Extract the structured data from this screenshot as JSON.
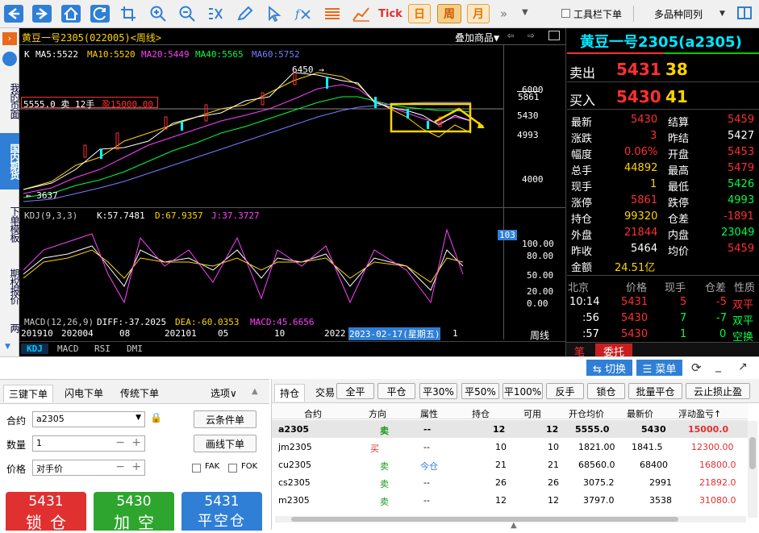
{
  "toolbar": {
    "back": "back-icon",
    "forward": "forward-icon",
    "home": "home-icon",
    "refresh": "refresh-icon",
    "crop": "crop-icon",
    "zoom_in": "zoom-in-icon",
    "zoom_out": "zoom-out-icon",
    "formula": "formula-icon",
    "draw": "pen-icon",
    "cursor": "cursor-icon",
    "fx": "fx-icon",
    "list": "list-icon",
    "kline": "kline-icon",
    "tick_label": "Tick",
    "day_label": "日",
    "week_label": "周",
    "month_label": "月",
    "toolbar_order_label": "工具栏下单",
    "multi_same_label": "多品种同列"
  },
  "leftnav": {
    "my_page": "我的页面",
    "domestic": "国内期货",
    "order_template": "下单模板",
    "options": "期权报价",
    "more": "两"
  },
  "chart": {
    "header_title": "黄豆一号2305(022005)<周线>",
    "overlay_label": "叠加商品▼",
    "ma_k": "K",
    "ma5": "MA5:5522",
    "ma10": "MA10:5520",
    "ma20": "MA20:5449",
    "ma40": "MA40:5565",
    "ma60": "MA60:5752",
    "position_line": "5555.0 卖 12手",
    "position_profit": "盈15000.00",
    "high_label": "6450 →",
    "low_label": "← 3637",
    "price_ticks": [
      "6000",
      "5861",
      "5430",
      "4993",
      "4000"
    ],
    "kdj_label": "KDJ(9,3,3)",
    "kdj_k": "K:57.7481",
    "kdj_d": "D:67.9357",
    "kdj_j": "J:37.3727",
    "kdj_box": "103",
    "kdj_ticks": [
      "100.00",
      "80.00",
      "50.00",
      "20.00",
      "0.00"
    ],
    "macd_label": "MACD(12,26,9)",
    "macd_diff": "DIFF:-37.2025",
    "macd_dea": "DEA:-60.0353",
    "macd_val": "MACD:45.6656",
    "date_ticks": [
      "201910",
      "202004",
      "08",
      "202101",
      "05",
      "10",
      "2022"
    ],
    "date_box": "2023-02-17(星期五)",
    "date_tail": "1",
    "zhouxian": "周线",
    "tabs": [
      "KDJ",
      "MACD",
      "RSI",
      "DMI"
    ]
  },
  "quote": {
    "title": "黄豆一号2305(a2305)",
    "sell_label": "卖出",
    "sell_price": "5431",
    "sell_vol": "38",
    "buy_label": "买入",
    "buy_price": "5430",
    "buy_vol": "41",
    "rows": [
      [
        "最新",
        "5430",
        "结算",
        "5459"
      ],
      [
        "涨跌",
        "3",
        "昨结",
        "5427"
      ],
      [
        "幅度",
        "0.06%",
        "开盘",
        "5453"
      ],
      [
        "总手",
        "44892",
        "最高",
        "5479"
      ],
      [
        "现手",
        "1",
        "最低",
        "5426"
      ],
      [
        "涨停",
        "5861",
        "跌停",
        "4993"
      ],
      [
        "持仓",
        "99320",
        "仓差",
        "-1891"
      ],
      [
        "外盘",
        "21844",
        "内盘",
        "23049"
      ],
      [
        "昨收",
        "5464",
        "均价",
        "5459"
      ],
      [
        "金额",
        "24.51亿",
        "",
        ""
      ]
    ],
    "tick_header": [
      "北京",
      "价格",
      "现手",
      "仓差",
      "性质"
    ],
    "ticks": [
      [
        "10:14",
        "5431",
        "5",
        "-5",
        "双平"
      ],
      [
        ":56",
        "5430",
        "7",
        "-7",
        "双平"
      ],
      [
        ":57",
        "5430",
        "1",
        "0",
        "空换"
      ]
    ],
    "tab_bi": "笔",
    "tab_weituo": "委托"
  },
  "midbar": {
    "switch_label": "⇆ 切换",
    "menu_label": "☰ 菜单"
  },
  "order": {
    "tabs": [
      "三键下单",
      "闪电下单",
      "传统下单",
      "选项∨"
    ],
    "contract_label": "合约",
    "contract_value": "a2305",
    "qty_label": "数量",
    "qty_value": "1",
    "price_label": "价格",
    "price_value": "对手价",
    "cloud_btn": "云条件单",
    "draw_btn": "画线下单",
    "fak": "FAK",
    "fok": "FOK",
    "btn1_price": "5431",
    "btn1_label": "锁仓",
    "btn2_price": "5430",
    "btn2_label": "加空",
    "btn3_price": "5431",
    "btn3_label": "平空仓"
  },
  "positions": {
    "tab_hold": "持仓",
    "tab_trade": "交易",
    "buttons": [
      "全平",
      "平仓",
      "平30%",
      "平50%",
      "平100%",
      "反手",
      "锁仓",
      "批量平仓",
      "云止损止盈"
    ],
    "headers": [
      "合约",
      "方向",
      "属性",
      "持仓",
      "可用",
      "开仓均价",
      "最新价",
      "浮动盈亏↑"
    ],
    "rows": [
      [
        "a2305",
        "卖",
        "--",
        "12",
        "12",
        "5555.0",
        "5430",
        "15000.0"
      ],
      [
        "jm2305",
        "买",
        "--",
        "10",
        "10",
        "1821.00",
        "1841.5",
        "12300.00"
      ],
      [
        "cu2305",
        "卖",
        "今仓",
        "21",
        "21",
        "68560.0",
        "68400",
        "16800.0"
      ],
      [
        "cs2305",
        "卖",
        "--",
        "26",
        "26",
        "3075.2",
        "2991",
        "21892.0"
      ],
      [
        "m2305",
        "卖",
        "--",
        "12",
        "12",
        "3797.0",
        "3538",
        "31080.0"
      ]
    ]
  }
}
